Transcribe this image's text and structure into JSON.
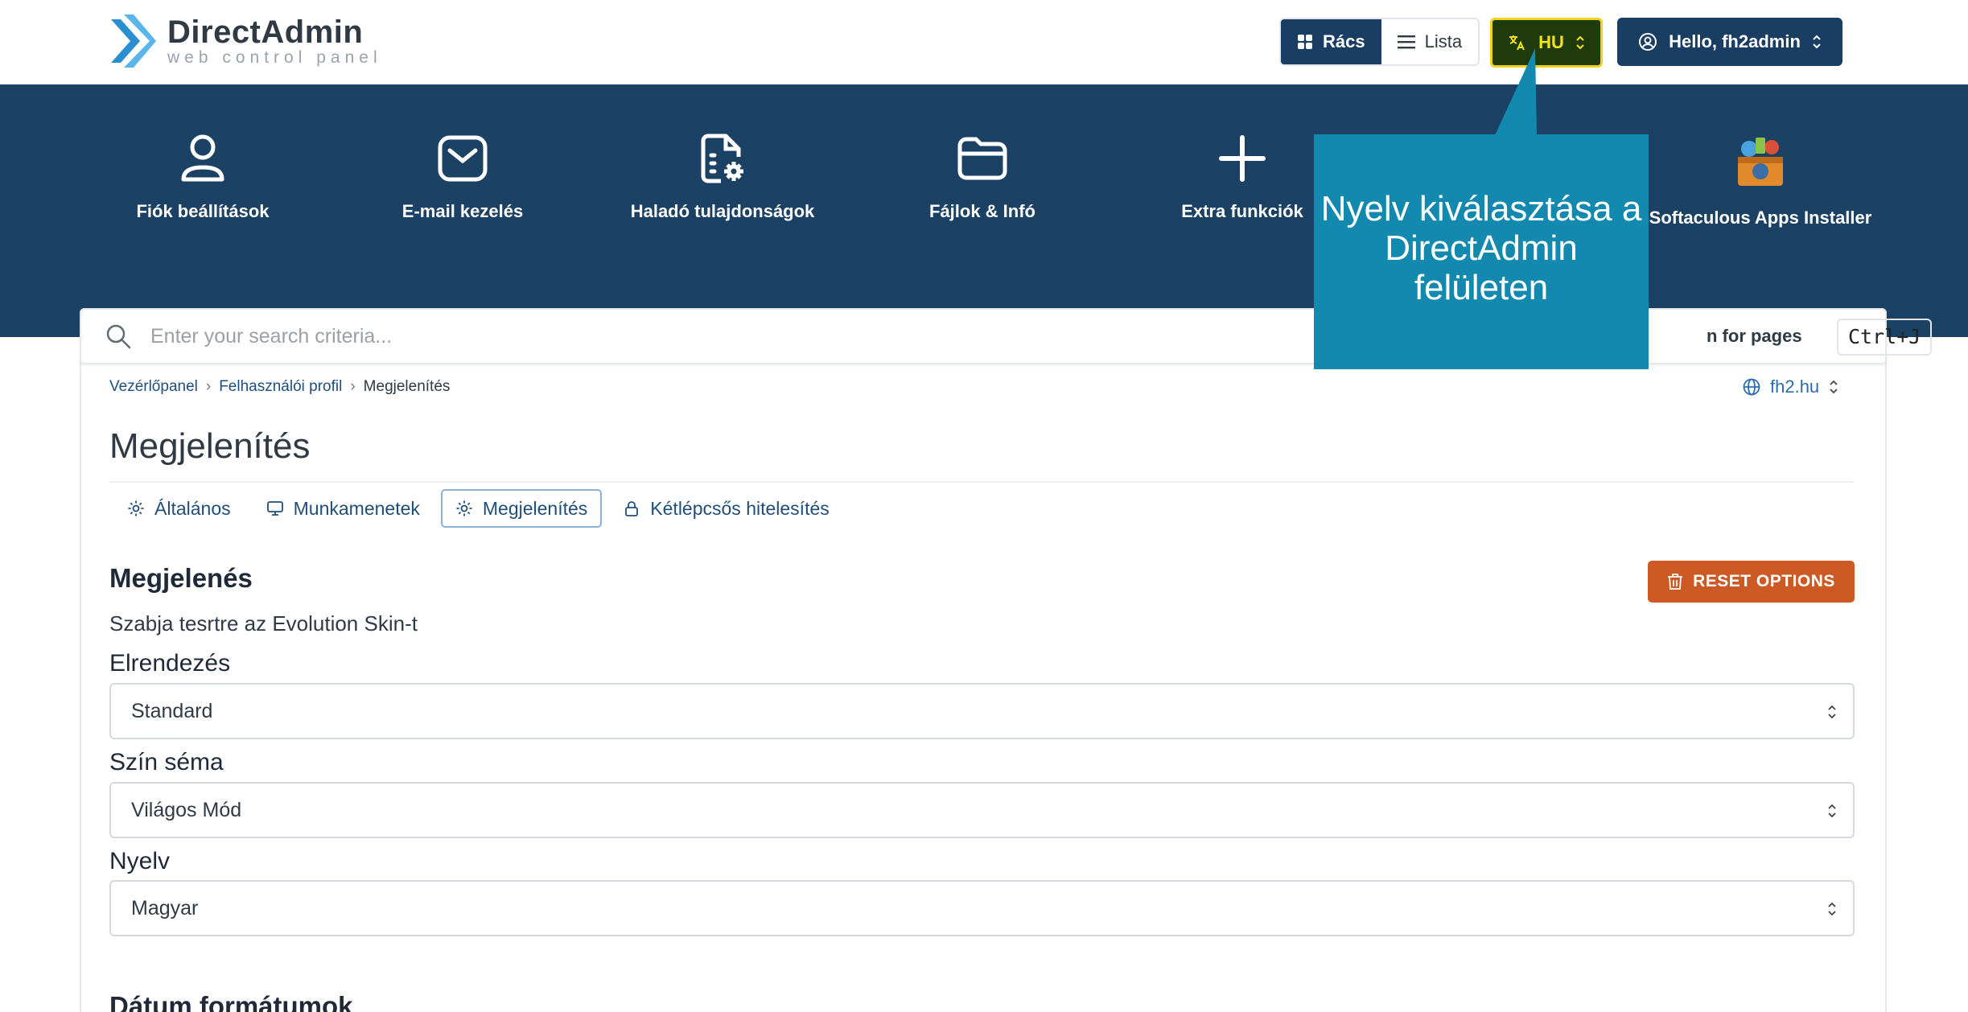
{
  "brand": {
    "name": "DirectAdmin",
    "tagline": "web control panel"
  },
  "header": {
    "view_grid": "Rács",
    "view_list": "Lista",
    "language": "HU",
    "user": "Hello, fh2admin"
  },
  "nav": {
    "items": [
      {
        "label": "Fiók beállítások",
        "icon": "user-icon"
      },
      {
        "label": "E-mail kezelés",
        "icon": "mail-icon"
      },
      {
        "label": "Haladó tulajdonságok",
        "icon": "file-gear-icon"
      },
      {
        "label": "Fájlok & Infó",
        "icon": "folder-icon"
      },
      {
        "label": "Extra funkciók",
        "icon": "plus-icon"
      },
      {
        "label": "Softaculous Apps Installer",
        "icon": "softaculous-icon"
      }
    ]
  },
  "tooltip": {
    "text": "Nyelv kiválasztása a DirectAdmin felületen"
  },
  "search": {
    "placeholder": "Enter your search criteria...",
    "hint": "n for pages",
    "shortcut": "Ctrl+J"
  },
  "breadcrumb": {
    "items": [
      "Vezérlőpanel",
      "Felhasználói profil",
      "Megjelenítés"
    ]
  },
  "domain": "fh2.hu",
  "page": {
    "title": "Megjelenítés"
  },
  "tabs": [
    {
      "label": "Általános",
      "icon": "gear-icon"
    },
    {
      "label": "Munkamenetek",
      "icon": "monitor-icon"
    },
    {
      "label": "Megjelenítés",
      "icon": "gear-icon",
      "active": true
    },
    {
      "label": "Kétlépcsős hitelesítés",
      "icon": "lock-icon"
    }
  ],
  "appearance": {
    "title": "Megjelenés",
    "description": "Szabja tesrtre az Evolution Skin-t",
    "reset": "RESET OPTIONS",
    "layout_label": "Elrendezés",
    "layout_value": "Standard",
    "scheme_label": "Szín séma",
    "scheme_value": "Világos Mód",
    "language_label": "Nyelv",
    "language_value": "Magyar"
  },
  "date_section": {
    "title": "Dátum formátumok"
  },
  "colors": {
    "primary": "#1a3d63",
    "nav_bg": "#1b4164",
    "accent": "#cd5a24",
    "tooltip": "#1389b0",
    "lang_highlight": "#f0d31a"
  }
}
